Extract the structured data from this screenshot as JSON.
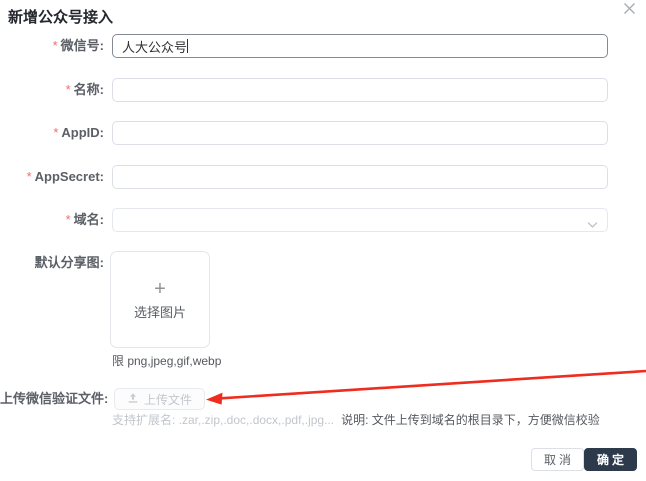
{
  "dialog": {
    "title": "新增公众号接入",
    "close_icon": "close-x"
  },
  "form": {
    "fields": [
      {
        "required_mark": "*",
        "label": "微信号:",
        "value": "人大公众号",
        "state": "focused"
      },
      {
        "required_mark": "*",
        "label": "名称:",
        "value": ""
      },
      {
        "required_mark": "*",
        "label": "AppID:",
        "value": ""
      },
      {
        "required_mark": "*",
        "label": "AppSecret:",
        "value": ""
      },
      {
        "required_mark": "*",
        "label": "域名:",
        "value": "",
        "type": "select"
      }
    ]
  },
  "share": {
    "label": "默认分享图:",
    "plus": "+",
    "button_text": "选择图片",
    "hint": "限 png,jpeg,gif,webp"
  },
  "verify": {
    "label": "上传微信验证文件:",
    "button_text": "上传文件",
    "ext_hint": "支持扩展名: .zar,.zip,.doc,.docx,.pdf,.jpg...",
    "note": "说明: 文件上传到域名的根目录下，方便微信校验"
  },
  "footer": {
    "cancel_label": "取消",
    "confirm_label": "确定"
  },
  "colors": {
    "primary": "#2d3a4b",
    "required": "#f56c6c",
    "arrow": "#ee2c1f",
    "disabled_text": "#c0c4cc"
  },
  "icons": {
    "close": "✕",
    "chevron_down": "⌄",
    "upload": "⬆",
    "plus": "+"
  }
}
